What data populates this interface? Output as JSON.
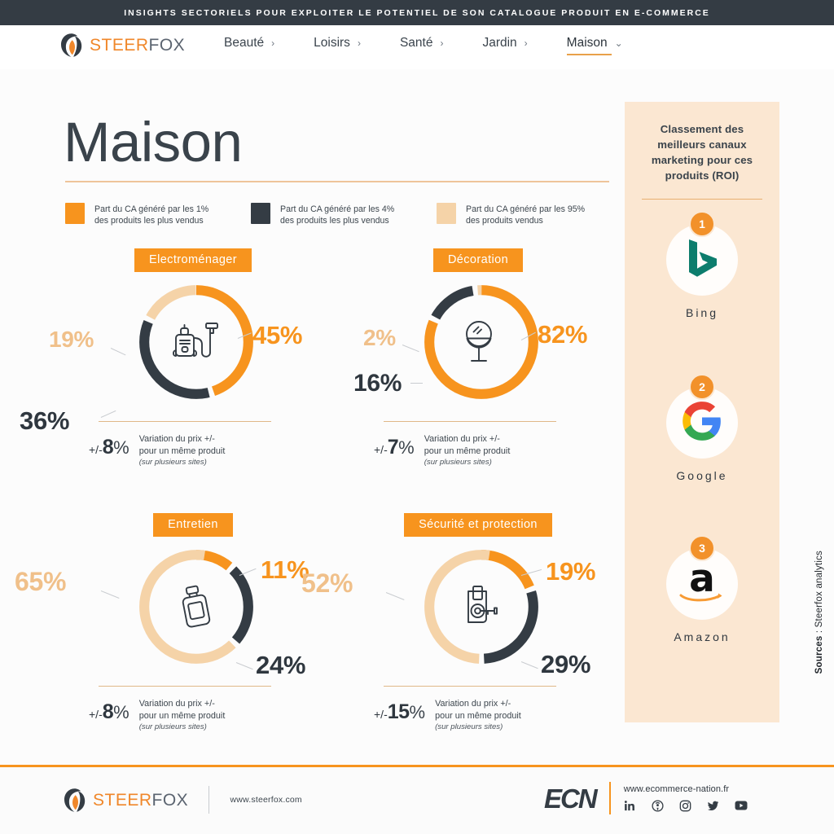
{
  "topbar": {
    "text": "INSIGHTS SECTORIELS POUR EXPLOITER LE POTENTIEL DE SON CATALOGUE PRODUIT EN E-COMMERCE"
  },
  "brand": {
    "steer": "STEER",
    "fox": "FOX"
  },
  "nav": {
    "items": [
      {
        "label": "Beauté",
        "chev": "›",
        "active": false
      },
      {
        "label": "Loisirs",
        "chev": "›",
        "active": false
      },
      {
        "label": "Santé",
        "chev": "›",
        "active": false
      },
      {
        "label": "Jardin",
        "chev": "›",
        "active": false
      },
      {
        "label": "Maison",
        "chev": "⌄",
        "active": true
      }
    ]
  },
  "page_title": "Maison",
  "colors": {
    "orange": "#f7941e",
    "dark": "#343c44",
    "light": "#f5d3a8",
    "panel_bg": "#fbe7d2",
    "rule": "#eec49a"
  },
  "legend": [
    {
      "color": "#f7941e",
      "line1": "Part du CA généré par les 1%",
      "line2": "des produits les plus vendus"
    },
    {
      "color": "#343c44",
      "line1": "Part du CA généré par les 4%",
      "line2": "des produits les plus vendus"
    },
    {
      "color": "#f5d3a8",
      "line1": "Part du CA généré par les 95%",
      "line2": "des produits vendus"
    }
  ],
  "variation": {
    "prefix": "+/-",
    "desc_line1": "Variation du prix +/-",
    "desc_line2": "pour un même produit",
    "desc_sub": "(sur plusieurs sites)"
  },
  "chart_data": [
    {
      "type": "pie",
      "title": "Electroménager",
      "icon": "vacuum-cleaner-icon",
      "categories": [
        "Part du CA généré par les 1% des produits les plus vendus",
        "Part du CA généré par les 4% des produits les plus vendus",
        "Part du CA généré par les 95% des produits vendus"
      ],
      "values": [
        45,
        36,
        19
      ],
      "labels": [
        "45%",
        "36%",
        "19%"
      ],
      "colors": [
        "#f7941e",
        "#343c44",
        "#f5d3a8"
      ],
      "price_variation": "8",
      "price_variation_label": "+/- 8%"
    },
    {
      "type": "pie",
      "title": "Décoration",
      "icon": "vanity-mirror-icon",
      "categories": [
        "Part du CA généré par les 1% des produits les plus vendus",
        "Part du CA généré par les 4% des produits les plus vendus",
        "Part du CA généré par les 95% des produits vendus"
      ],
      "values": [
        82,
        16,
        2
      ],
      "labels": [
        "82%",
        "16%",
        "2%"
      ],
      "colors": [
        "#f7941e",
        "#343c44",
        "#f5d3a8"
      ],
      "price_variation": "7",
      "price_variation_label": "+/- 7%"
    },
    {
      "type": "pie",
      "title": "Entretien",
      "icon": "cleaning-bottle-icon",
      "categories": [
        "Part du CA généré par les 1% des produits les plus vendus",
        "Part du CA généré par les 4% des produits les plus vendus",
        "Part du CA généré par les 95% des produits vendus"
      ],
      "values": [
        11,
        24,
        65
      ],
      "labels": [
        "11%",
        "24%",
        "65%"
      ],
      "colors": [
        "#f7941e",
        "#343c44",
        "#f5d3a8"
      ],
      "price_variation": "8",
      "price_variation_label": "+/- 8%"
    },
    {
      "type": "pie",
      "title": "Sécurité et protection",
      "icon": "door-lock-icon",
      "categories": [
        "Part du CA généré par les 1% des produits les plus vendus",
        "Part du CA généré par les 4% des produits les plus vendus",
        "Part du CA généré par les 95% des produits vendus"
      ],
      "values": [
        19,
        29,
        52
      ],
      "labels": [
        "19%",
        "29%",
        "52%"
      ],
      "colors": [
        "#f7941e",
        "#343c44",
        "#f5d3a8"
      ],
      "price_variation": "15",
      "price_variation_label": "+/- 15%"
    }
  ],
  "panel": {
    "title": "Classement des meilleurs canaux marketing pour ces produits (ROI)",
    "ranks": [
      {
        "num": "1",
        "label": "Bing",
        "icon": "bing-logo-icon"
      },
      {
        "num": "2",
        "label": "Google",
        "icon": "google-logo-icon"
      },
      {
        "num": "3",
        "label": "Amazon",
        "icon": "amazon-logo-icon"
      }
    ]
  },
  "sources": {
    "bold": "Sources",
    "text": " : Steerfox analytics"
  },
  "footer": {
    "steerfox_url": "www.steerfox.com",
    "ecn_logo": "ECN",
    "ecn_url": "www.ecommerce-nation.fr",
    "socials": [
      "linkedin-icon",
      "podcast-icon",
      "instagram-icon",
      "twitter-icon",
      "youtube-icon"
    ]
  }
}
